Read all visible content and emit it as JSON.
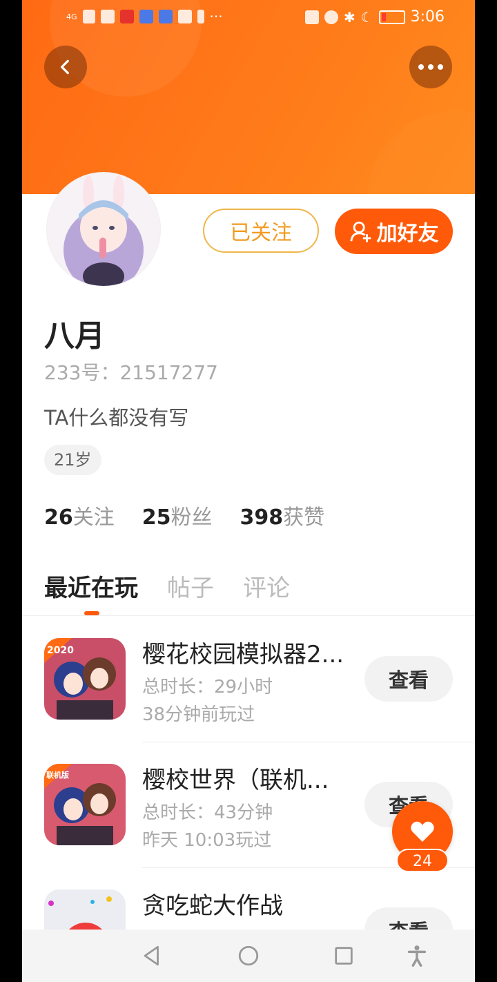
{
  "status_bar": {
    "signal_text": "4G",
    "time": "3:06"
  },
  "header": {
    "back_icon": "chevron-left-icon",
    "more_icon": "more-dots-icon"
  },
  "profile": {
    "follow_label": "已关注",
    "add_friend_label": "加好友",
    "name": "八月",
    "id_text": "233号：21517277",
    "bio": "TA什么都没有写",
    "age_tag": "21岁",
    "stats": [
      {
        "num": "26",
        "label": "关注"
      },
      {
        "num": "25",
        "label": "粉丝"
      },
      {
        "num": "398",
        "label": "获赞"
      }
    ]
  },
  "tabs": [
    {
      "label": "最近在玩",
      "active": true
    },
    {
      "label": "帖子",
      "active": false
    },
    {
      "label": "评论",
      "active": false
    }
  ],
  "games": [
    {
      "title": "樱花校园模拟器2...",
      "line1": "总时长：29小时",
      "line2": "38分钟前玩过",
      "badge": "2020",
      "view_label": "查看"
    },
    {
      "title": "樱校世界（联机...",
      "line1": "总时长：43分钟",
      "line2": "昨天 10:03玩过",
      "badge": "联机版",
      "view_label": "查看"
    },
    {
      "title": "贪吃蛇大作战",
      "line1": "",
      "line2": "",
      "badge": "",
      "view_label": "查看"
    }
  ],
  "like": {
    "count": "24",
    "icon": "heart-icon"
  },
  "colors": {
    "brand_orange": "#ff5a0a",
    "banner_orange": "#ff7a1a",
    "follow_border": "#f0b64a"
  }
}
